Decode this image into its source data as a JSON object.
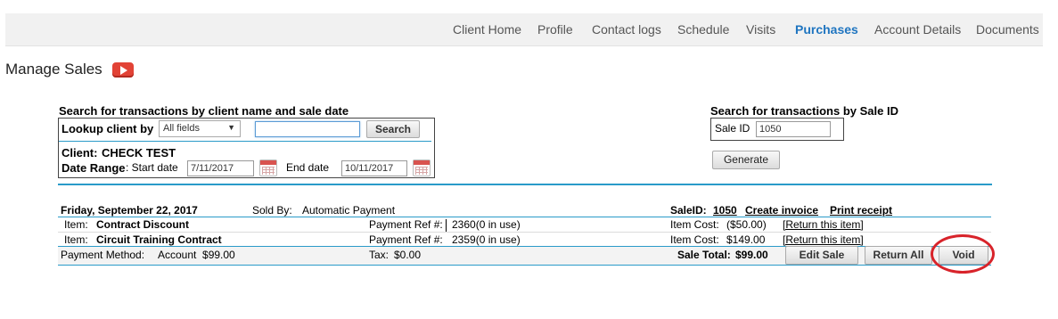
{
  "nav": {
    "items": [
      {
        "label": "Client Home",
        "active": false
      },
      {
        "label": "Profile",
        "active": false
      },
      {
        "label": "Contact logs",
        "active": false
      },
      {
        "label": "Schedule",
        "active": false
      },
      {
        "label": "Visits",
        "active": false
      },
      {
        "label": "Purchases",
        "active": true
      },
      {
        "label": "Account Details",
        "active": false
      },
      {
        "label": "Documents",
        "active": false
      }
    ]
  },
  "page": {
    "title": "Manage Sales",
    "video_icon": "youtube-play-icon"
  },
  "search_by_client": {
    "heading": "Search for transactions by client name and sale date",
    "lookup_label": "Lookup client by",
    "lookup_selected": "All fields",
    "lookup_input_value": "",
    "search_button": "Search",
    "client_label": "Client:",
    "client_name": "CHECK TEST",
    "date_range_label": "Date Range",
    "start_date_label": ": Start date",
    "start_date": "7/11/2017",
    "end_date_label": "End date",
    "end_date": "10/11/2017"
  },
  "search_by_id": {
    "heading": "Search for transactions by Sale ID",
    "sale_id_label": "Sale ID",
    "sale_id_value": "1050",
    "generate_button": "Generate"
  },
  "sale": {
    "date": "Friday, September 22, 2017",
    "sold_by_label": "Sold By:",
    "sold_by": "Automatic Payment",
    "sale_id_label": "SaleID:",
    "sale_id": "1050",
    "create_invoice": "Create invoice",
    "print_receipt": "Print receipt",
    "items": [
      {
        "item_label": "Item:",
        "name": "Contract Discount",
        "payment_ref_label": "Payment Ref #:",
        "payment_ref": "2360(0 in use)",
        "cost_label": "Item Cost:",
        "cost": "($50.00)",
        "return_link": "[Return this item]"
      },
      {
        "item_label": "Item:",
        "name": "Circuit Training Contract",
        "payment_ref_label": "Payment Ref #:",
        "payment_ref": "2359(0 in use)",
        "cost_label": "Item Cost:",
        "cost": "$149.00",
        "return_link": "[Return this item]"
      }
    ],
    "payment_method_label": "Payment Method:",
    "payment_method": "Account  $99.00",
    "tax_label": "Tax:",
    "tax": "$0.00",
    "sale_total_label": "Sale Total:",
    "sale_total": "$99.00",
    "edit_sale_button": "Edit Sale",
    "return_all_button": "Return All",
    "void_button": "Void"
  },
  "colors": {
    "accent": "#1f75c0",
    "divider": "#2a9bc9",
    "highlight": "#d8232a"
  }
}
